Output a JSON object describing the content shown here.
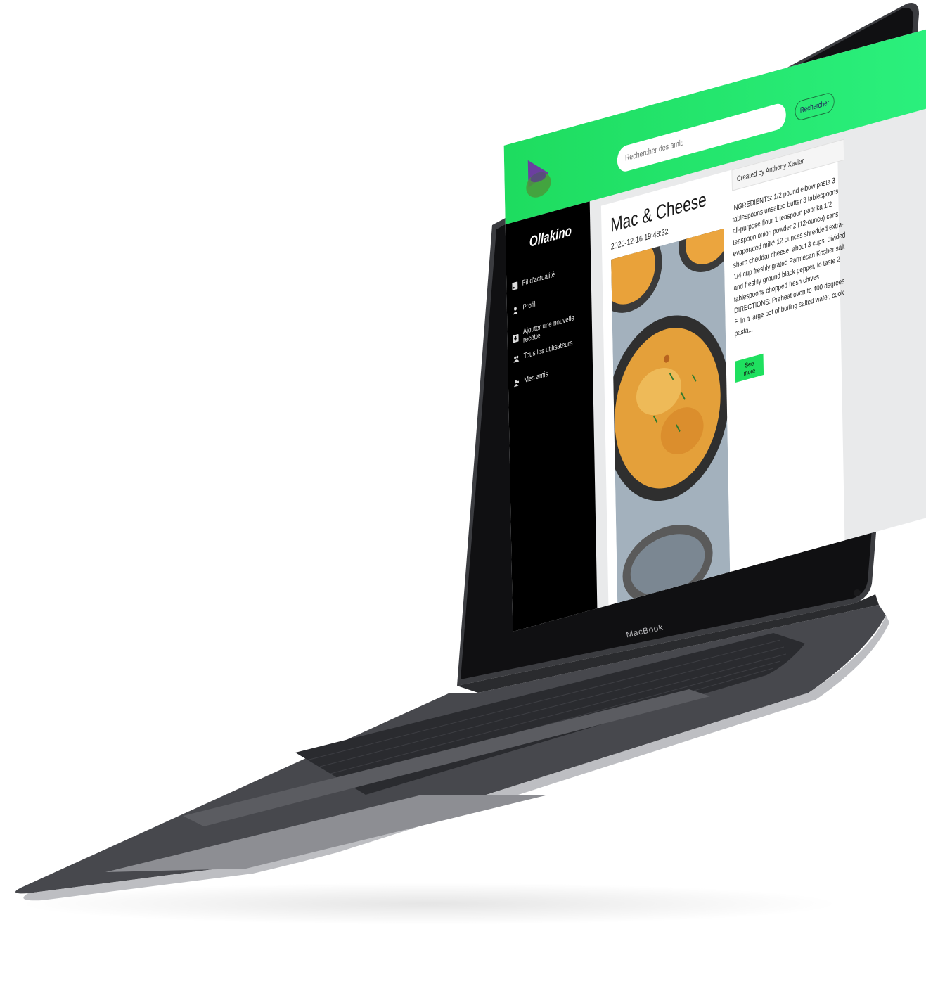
{
  "device": {
    "label": "MacBook"
  },
  "header": {
    "search": {
      "placeholder": "Rechercher des amis"
    },
    "search_button_label": "Rechercher"
  },
  "sidebar": {
    "brand": "Ollakino",
    "items": [
      {
        "label": "Fil d'actualité",
        "icon": "rss-icon"
      },
      {
        "label": "Profil",
        "icon": "user-icon"
      },
      {
        "label": "Ajouter une nouvelle recette",
        "icon": "plus-square-icon"
      },
      {
        "label": "Tous les utilisateurs",
        "icon": "users-icon"
      },
      {
        "label": "Mes amis",
        "icon": "user-friends-icon"
      }
    ]
  },
  "post": {
    "title": "Mac & Cheese",
    "date": "2020-12-16 19:48:32",
    "author": "Created by Anthony Xavier",
    "body": "INGREDIENTS: 1/2 pound elbow pasta 3 tablespoons unsalted butter 3 tablespoons all-purpose flour 1 teaspoon paprika 1/2 teaspoon onion powder 2 (12-ounce) cans evaporated milk* 12 ounces shredded extra-sharp cheddar cheese, about 3 cups, divided 1/4 cup freshly grated Parmesan Kosher salt and freshly ground black pepper, to taste 2 tablespoons chopped fresh chives DIRECTIONS: Preheat oven to 400 degrees F. In a large pot of boiling salted water, cook pasta...",
    "see_more_label": "See more"
  },
  "colors": {
    "accent_green": "#22e46a",
    "sidebar_bg": "#000000",
    "logo_purple": "#6b3fa0",
    "logo_green": "#4a9a3a"
  }
}
